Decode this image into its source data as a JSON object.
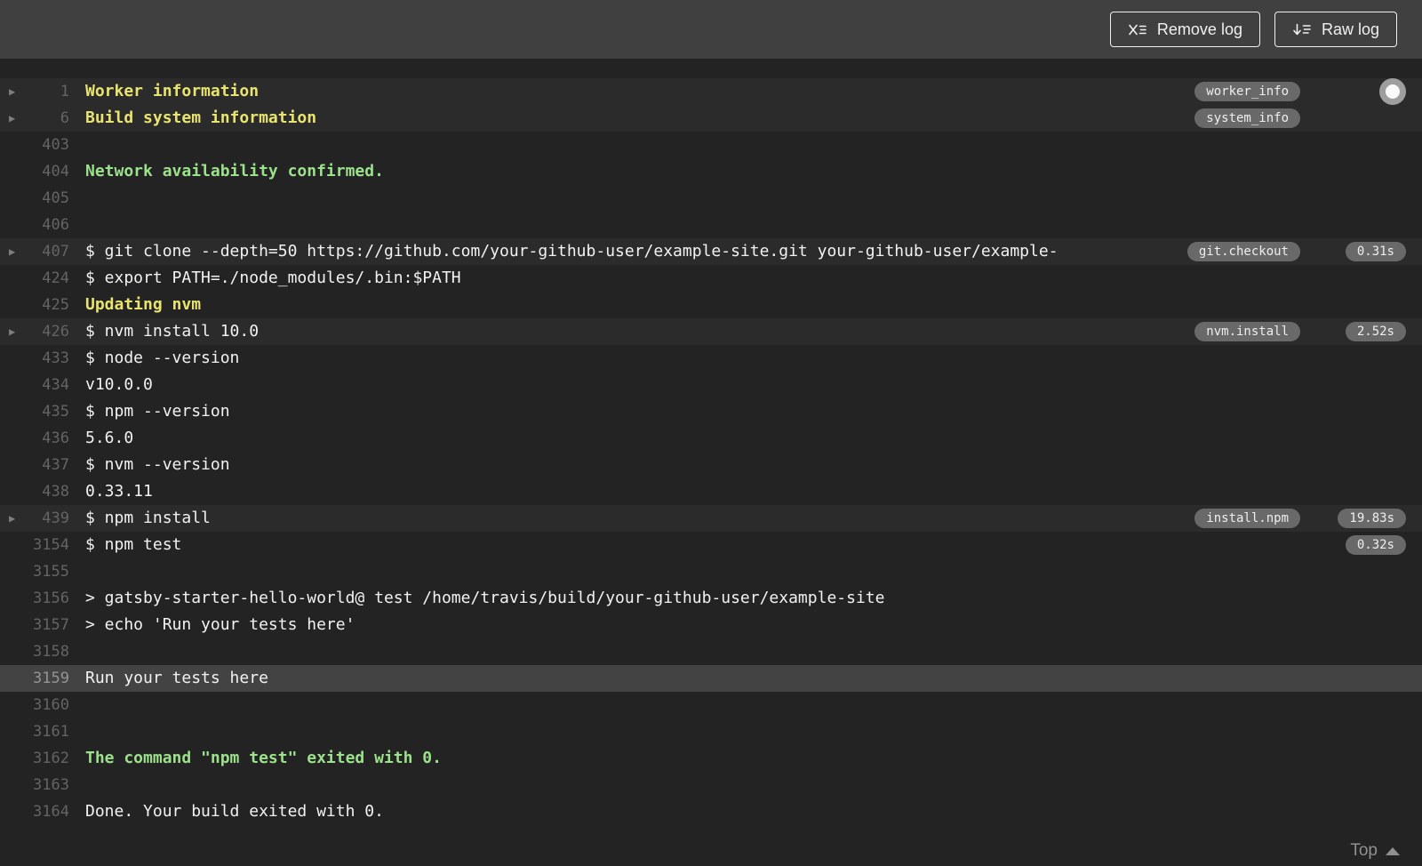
{
  "toolbar": {
    "remove_log_label": "Remove log",
    "raw_log_label": "Raw log"
  },
  "log": {
    "rows": [
      {
        "num": "1",
        "text": "Worker information",
        "color": "yellow",
        "fold": true,
        "row_style": "fold-header",
        "tag": "worker_info",
        "marker": true
      },
      {
        "num": "6",
        "text": "Build system information",
        "color": "yellow",
        "fold": true,
        "row_style": "fold-header",
        "tag": "system_info"
      },
      {
        "num": "403",
        "text": ""
      },
      {
        "num": "404",
        "text": "Network availability confirmed.",
        "color": "green"
      },
      {
        "num": "405",
        "text": ""
      },
      {
        "num": "406",
        "text": ""
      },
      {
        "num": "407",
        "text": "$ git clone --depth=50 https://github.com/your-github-user/example-site.git your-github-user/example-",
        "fold": true,
        "row_style": "fold-header",
        "tag": "git.checkout",
        "duration": "0.31s"
      },
      {
        "num": "424",
        "text": "$ export PATH=./node_modules/.bin:$PATH"
      },
      {
        "num": "425",
        "text": "Updating nvm",
        "color": "yellow"
      },
      {
        "num": "426",
        "text": "$ nvm install 10.0",
        "fold": true,
        "row_style": "fold-header",
        "tag": "nvm.install",
        "duration": "2.52s"
      },
      {
        "num": "433",
        "text": "$ node --version"
      },
      {
        "num": "434",
        "text": "v10.0.0"
      },
      {
        "num": "435",
        "text": "$ npm --version"
      },
      {
        "num": "436",
        "text": "5.6.0"
      },
      {
        "num": "437",
        "text": "$ nvm --version"
      },
      {
        "num": "438",
        "text": "0.33.11"
      },
      {
        "num": "439",
        "text": "$ npm install",
        "fold": true,
        "row_style": "fold-header",
        "tag": "install.npm",
        "duration": "19.83s"
      },
      {
        "num": "3154",
        "text": "$ npm test",
        "duration": "0.32s"
      },
      {
        "num": "3155",
        "text": ""
      },
      {
        "num": "3156",
        "text": "> gatsby-starter-hello-world@ test /home/travis/build/your-github-user/example-site"
      },
      {
        "num": "3157",
        "text": "> echo 'Run your tests here'"
      },
      {
        "num": "3158",
        "text": ""
      },
      {
        "num": "3159",
        "text": "Run your tests here",
        "row_style": "selected"
      },
      {
        "num": "3160",
        "text": ""
      },
      {
        "num": "3161",
        "text": ""
      },
      {
        "num": "3162",
        "text": "The command \"npm test\" exited with 0.",
        "color": "green"
      },
      {
        "num": "3163",
        "text": ""
      },
      {
        "num": "3164",
        "text": "Done. Your build exited with 0."
      }
    ]
  },
  "footer": {
    "top_label": "Top"
  },
  "colors": {
    "topbar_bg": "#404040",
    "log_bg": "#232323",
    "fold_row_bg": "#2b2b2b",
    "selected_row_bg": "#434343",
    "text": "#f2f2f2",
    "yellow": "#e9e46f",
    "green": "#9ce18b",
    "line_number": "#646464",
    "badge_bg": "#696969",
    "button_border": "#f0f0f0"
  }
}
